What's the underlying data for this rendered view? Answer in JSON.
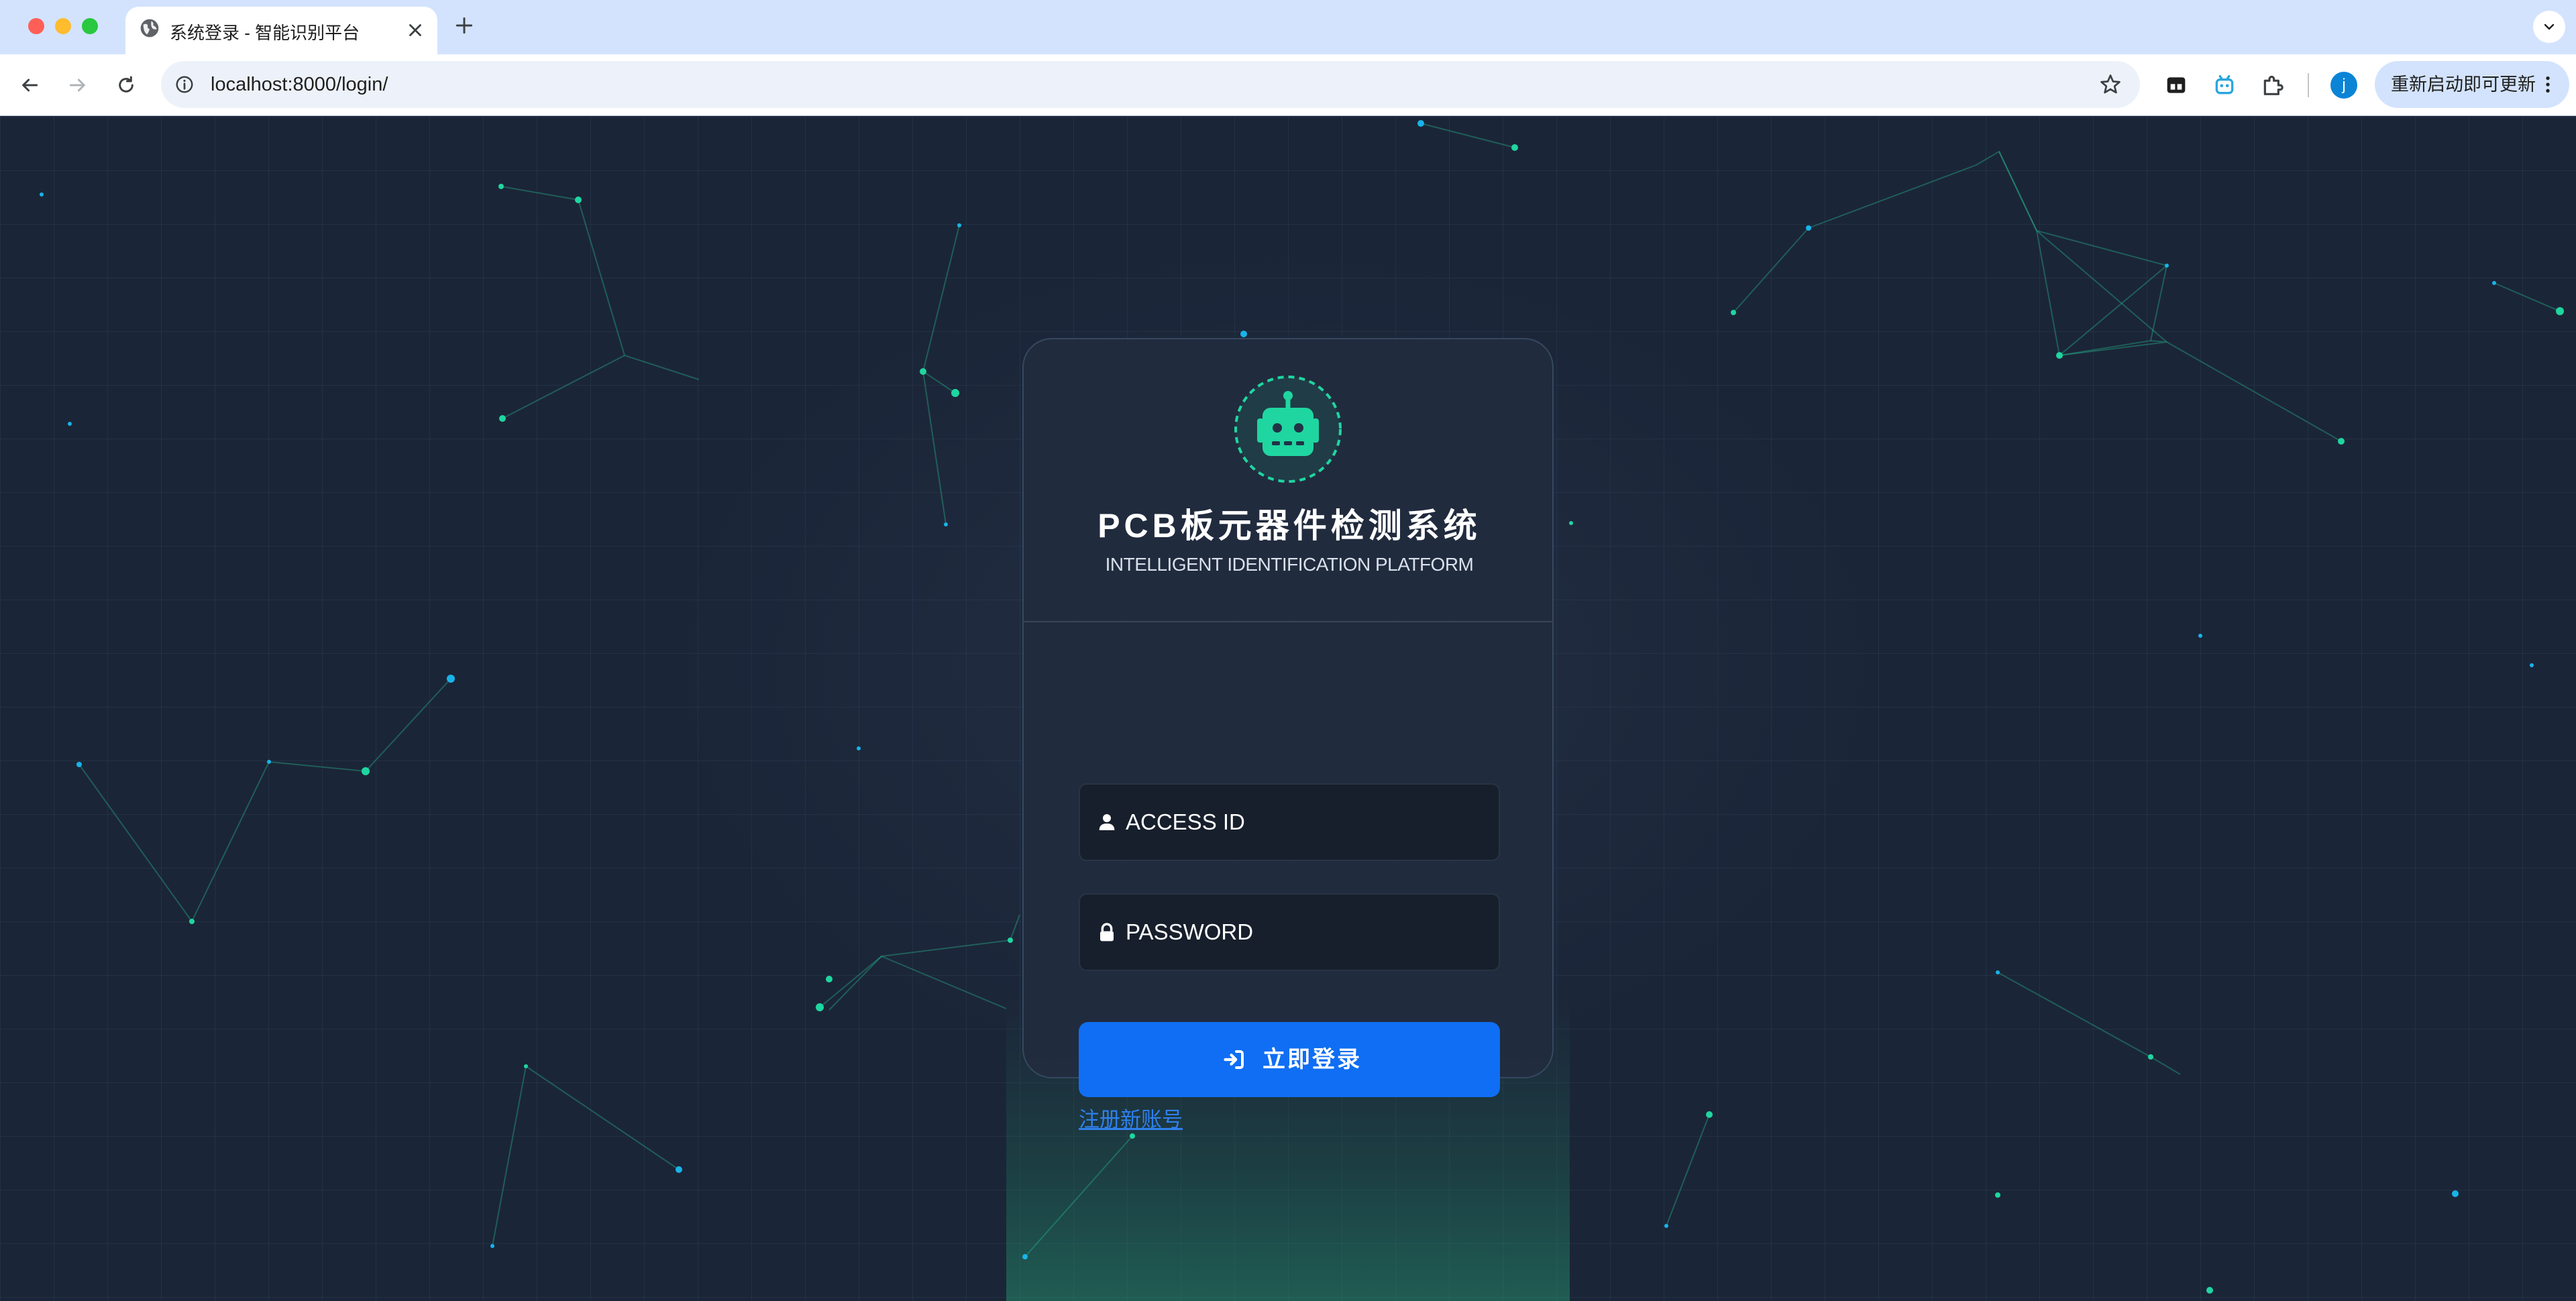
{
  "browser": {
    "tab_title": "系统登录 - 智能识别平台",
    "url": "localhost:8000/login/",
    "profile_initial": "j",
    "update_label": "重新启动即可更新"
  },
  "login": {
    "title": "PCB板元器件检测系统",
    "subtitle": "INTELLIGENT IDENTIFICATION PLATFORM",
    "username_placeholder": "ACCESS ID",
    "password_placeholder": "PASSWORD",
    "login_button": "立即登录",
    "register_link": "注册新账号"
  },
  "colors": {
    "background": "#1b2538",
    "accent_green": "#1fd6a0",
    "accent_cyan": "#18b4e8",
    "button_blue": "#0f6ef3",
    "link_blue": "#2f80ed"
  },
  "icons": [
    "globe-icon",
    "close-icon",
    "plus-icon",
    "chevron-down-icon",
    "back-arrow-icon",
    "forward-arrow-icon",
    "reload-icon",
    "info-icon",
    "star-icon",
    "extension-icon",
    "robot-icon",
    "user-icon",
    "lock-icon",
    "sign-in-icon",
    "more-vert-icon"
  ]
}
